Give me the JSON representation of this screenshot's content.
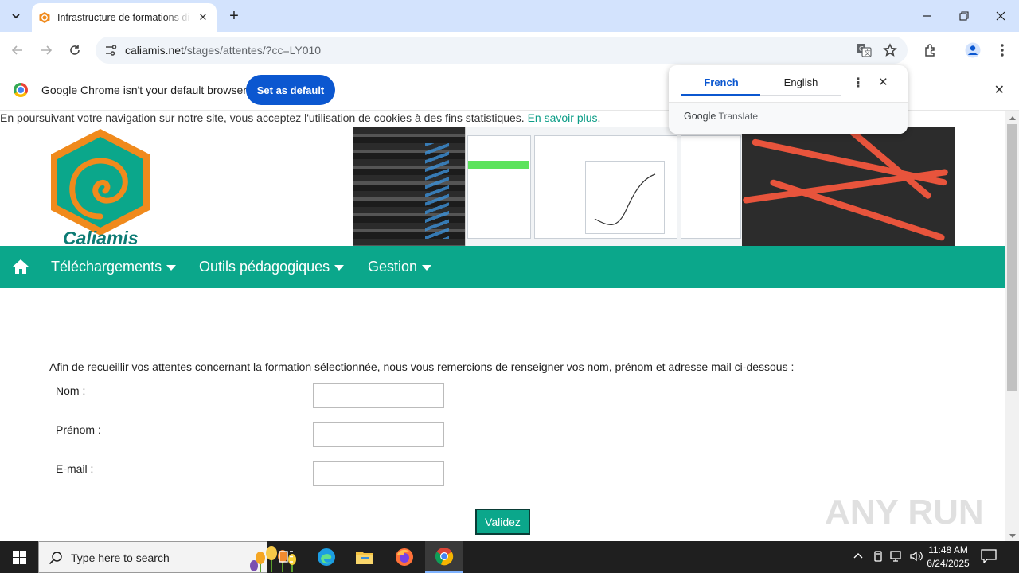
{
  "browser": {
    "tab_title": "Infrastructure de formations di",
    "url_host": "caliamis.net",
    "url_path": "/stages/attentes/?cc=LY010"
  },
  "infobar": {
    "message": "Google Chrome isn't your default browser",
    "set_default_label": "Set as default"
  },
  "translate_popup": {
    "source_lang": "French",
    "target_lang": "English",
    "brand_google": "Google",
    "brand_product": "Translate"
  },
  "page": {
    "cookie_notice": "En poursuivant votre navigation sur notre site, vous acceptez l'utilisation de cookies à des fins statistiques.",
    "cookie_link": "En savoir plus",
    "cookie_tail": ".",
    "logo_text": "Caliamis",
    "nav": {
      "items": [
        {
          "label": "Téléchargements"
        },
        {
          "label": "Outils pédagogiques"
        },
        {
          "label": "Gestion"
        }
      ]
    },
    "intro": "Afin de recueillir vos attentes concernant la formation sélectionnée, nous vous remercions de renseigner vos nom, prénom et adresse mail ci-dessous :",
    "form": {
      "fields": [
        {
          "label": "Nom :",
          "value": ""
        },
        {
          "label": "Prénom :",
          "value": ""
        },
        {
          "label": "E-mail :",
          "value": ""
        }
      ],
      "submit_label": "Validez"
    }
  },
  "taskbar": {
    "search_placeholder": "Type here to search",
    "time": "11:48 AM",
    "date": "6/24/2025"
  },
  "watermark": "ANY RUN",
  "colors": {
    "brand_teal": "#0ba78b",
    "chrome_blue": "#0b57d0",
    "logo_orange": "#f08a1c"
  }
}
